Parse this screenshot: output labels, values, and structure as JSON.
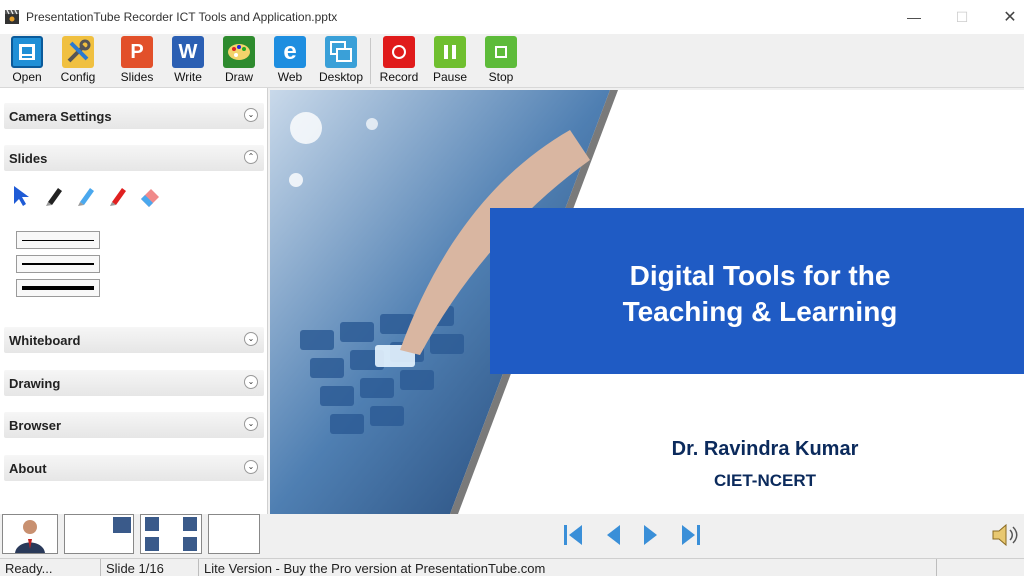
{
  "window": {
    "title": "PresentationTube Recorder ICT Tools and Application.pptx",
    "minimize": "—",
    "maximize": "☐",
    "close": "✕"
  },
  "toolbar": {
    "items": [
      {
        "label": "Open",
        "icon": "open-icon"
      },
      {
        "label": "Config",
        "icon": "config-icon"
      },
      {
        "label": "Slides",
        "icon": "powerpoint-icon"
      },
      {
        "label": "Write",
        "icon": "word-icon"
      },
      {
        "label": "Draw",
        "icon": "paint-icon"
      },
      {
        "label": "Web",
        "icon": "internet-explorer-icon"
      },
      {
        "label": "Desktop",
        "icon": "desktop-icon"
      },
      {
        "label": "Record",
        "icon": "record-icon"
      },
      {
        "label": "Pause",
        "icon": "pause-icon"
      },
      {
        "label": "Stop",
        "icon": "stop-icon"
      }
    ]
  },
  "sidebar": {
    "sections": [
      {
        "title": "Camera Settings",
        "state": "collapsed"
      },
      {
        "title": "Slides",
        "state": "expanded"
      },
      {
        "title": "Whiteboard",
        "state": "collapsed"
      },
      {
        "title": "Drawing",
        "state": "collapsed"
      },
      {
        "title": "Browser",
        "state": "collapsed"
      },
      {
        "title": "About",
        "state": "collapsed"
      }
    ],
    "slide_tools": [
      "pointer-icon",
      "black-pen-icon",
      "blue-pen-icon",
      "red-pen-icon",
      "eraser-icon"
    ],
    "line_widths": [
      "thin",
      "medium",
      "thick"
    ]
  },
  "slide": {
    "title": "Digital Tools for the Teaching & Learning",
    "author": "Dr. Ravindra Kumar",
    "organization": "CIET-NCERT",
    "colors": {
      "band": "#1f5bc4",
      "text": "#0b2a5c"
    }
  },
  "navigation": [
    "first-slide-icon",
    "previous-slide-icon",
    "next-slide-icon",
    "last-slide-icon"
  ],
  "statusbar": {
    "state": "Ready...",
    "slide": "Slide 1/16",
    "message": "Lite Version - Buy the Pro version at PresentationTube.com"
  },
  "colors": {
    "accent_blue": "#1f5bc4",
    "record_red": "#e01b1b",
    "pause_green": "#6fbf2f",
    "stop_green": "#5dbb3a"
  }
}
